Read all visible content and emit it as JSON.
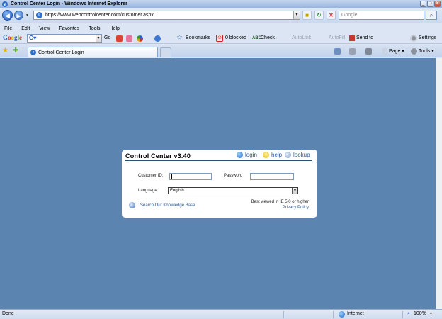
{
  "window": {
    "title": "Control Center Login - Windows Internet Explorer",
    "minimize": "_",
    "maximize": "□",
    "close": "✕"
  },
  "address_bar": {
    "url": "https://www.webcontrolcenter.com/customer.aspx",
    "search_placeholder": "Google"
  },
  "menu": [
    "File",
    "Edit",
    "View",
    "Favorites",
    "Tools",
    "Help"
  ],
  "google_toolbar": {
    "go": "Go",
    "bookmarks": "Bookmarks",
    "blocked": "0 blocked",
    "check": "Check",
    "autolink": "AutoLink",
    "autofill": "AutoFill",
    "send_to": "Send to",
    "settings": "Settings"
  },
  "tabs": {
    "active_tab": "Control Center Login",
    "page": "Page",
    "tools": "Tools"
  },
  "panel": {
    "title": "Control Center v3.40",
    "links": {
      "login": "login",
      "help": "help",
      "lookup": "lookup"
    },
    "customer_id_label": "Customer ID:",
    "customer_id_value": "",
    "password_label": "Password",
    "password_value": "",
    "language_label": "Language",
    "language_value": "English",
    "knowledge_base": "Search Our Knowledge Base",
    "best_viewed": "Best viewed in IE 5.0 or higher",
    "privacy": "Privacy Policy"
  },
  "status": {
    "text": "Done",
    "zone": "Internet",
    "zoom": "100%"
  },
  "colors": {
    "content_bg": "#5b84b1",
    "link": "#2d5a96",
    "chrome": "#dbe5f3"
  }
}
